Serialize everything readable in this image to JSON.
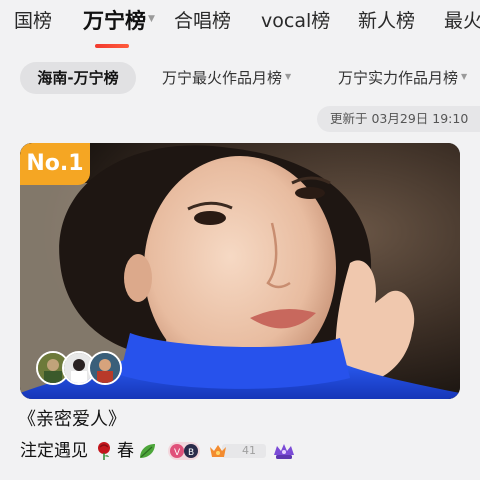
{
  "top_tabs": [
    {
      "label": "国榜"
    },
    {
      "label": "万宁榜",
      "active": true
    },
    {
      "label": "合唱榜"
    },
    {
      "label": "vocal榜"
    },
    {
      "label": "新人榜"
    },
    {
      "label": "最火"
    }
  ],
  "sub_tabs": [
    {
      "label": "海南-万宁榜",
      "active": true
    },
    {
      "label": "万宁最火作品月榜"
    },
    {
      "label": "万宁实力作品月榜"
    }
  ],
  "updated_text": "更新于 03月29日 19:10",
  "card": {
    "rank_label": "No.1"
  },
  "song": {
    "title": "《亲密爱人》",
    "artist": "注定遇见",
    "artist_suffix": "春"
  },
  "badges": {
    "vb_label": "V B",
    "level": "41"
  },
  "colors": {
    "accent": "#f23a2e",
    "rank_badge": "#f5a623",
    "sweater_blue": "#1f4bd8"
  }
}
